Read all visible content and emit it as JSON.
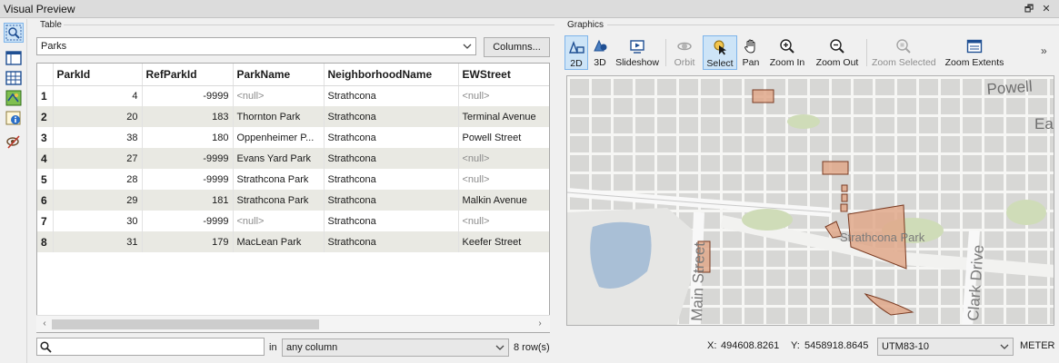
{
  "window": {
    "title": "Visual Preview",
    "restore_glyph": "🗗",
    "close_glyph": "✕"
  },
  "left_toolbar": [
    {
      "name": "inspect-icon",
      "active": true
    },
    {
      "name": "table-view-icon",
      "active": false
    },
    {
      "name": "grid-view-icon",
      "active": false
    },
    {
      "name": "map-view-icon",
      "active": false
    },
    {
      "name": "feature-info-icon",
      "active": false
    },
    {
      "name": "display-control-icon",
      "active": false
    }
  ],
  "table": {
    "section_label": "Table",
    "dataset": "Parks",
    "columns_button": "Columns...",
    "headers": [
      "",
      "ParkId",
      "RefParkId",
      "ParkName",
      "NeighborhoodName",
      "EWStreet"
    ],
    "rows": [
      [
        "1",
        "4",
        "-9999",
        "<null>",
        "Strathcona",
        "<null>"
      ],
      [
        "2",
        "20",
        "183",
        "Thornton Park",
        "Strathcona",
        "Terminal Avenue"
      ],
      [
        "3",
        "38",
        "180",
        "Oppenheimer P...",
        "Strathcona",
        "Powell Street"
      ],
      [
        "4",
        "27",
        "-9999",
        "Evans Yard Park",
        "Strathcona",
        "<null>"
      ],
      [
        "5",
        "28",
        "-9999",
        "Strathcona Park",
        "Strathcona",
        "<null>"
      ],
      [
        "6",
        "29",
        "181",
        "Strathcona Park",
        "Strathcona",
        "Malkin Avenue"
      ],
      [
        "7",
        "30",
        "-9999",
        "<null>",
        "Strathcona",
        "<null>"
      ],
      [
        "8",
        "31",
        "179",
        "MacLean Park",
        "Strathcona",
        "Keefer Street"
      ]
    ],
    "search_placeholder": "",
    "in_label": "in",
    "column_filter": "any column",
    "row_count": "8 row(s)"
  },
  "graphics": {
    "section_label": "Graphics",
    "tools": [
      {
        "id": "2d",
        "label": "2D",
        "state": "active"
      },
      {
        "id": "3d",
        "label": "3D",
        "state": "normal"
      },
      {
        "id": "slideshow",
        "label": "Slideshow",
        "state": "normal"
      },
      {
        "id": "orbit",
        "label": "Orbit",
        "state": "disabled"
      },
      {
        "id": "select",
        "label": "Select",
        "state": "active"
      },
      {
        "id": "pan",
        "label": "Pan",
        "state": "normal"
      },
      {
        "id": "zoom-in",
        "label": "Zoom In",
        "state": "normal"
      },
      {
        "id": "zoom-out",
        "label": "Zoom Out",
        "state": "normal"
      },
      {
        "id": "zoom-selected",
        "label": "Zoom Selected",
        "state": "disabled"
      },
      {
        "id": "zoom-extents",
        "label": "Zoom Extents",
        "state": "normal"
      }
    ],
    "overflow_glyph": "»",
    "map_labels": {
      "powell": "Powell",
      "east": "Eas",
      "strathcona_park": "Strathcona Park",
      "main_street": "Main Street",
      "clark_drive": "Clark Drive"
    },
    "status": {
      "x_label": "X:",
      "x_value": "494608.8261",
      "y_label": "Y:",
      "y_value": "5458918.8645",
      "crs": "UTM83-10",
      "units": "METER"
    },
    "colors": {
      "park_fill": "#e0a88a",
      "park_stroke": "#7a3b22",
      "water": "#a9bfd6",
      "green": "#cfdcb8",
      "street": "#ffffff",
      "block": "#d6d6d4"
    }
  }
}
